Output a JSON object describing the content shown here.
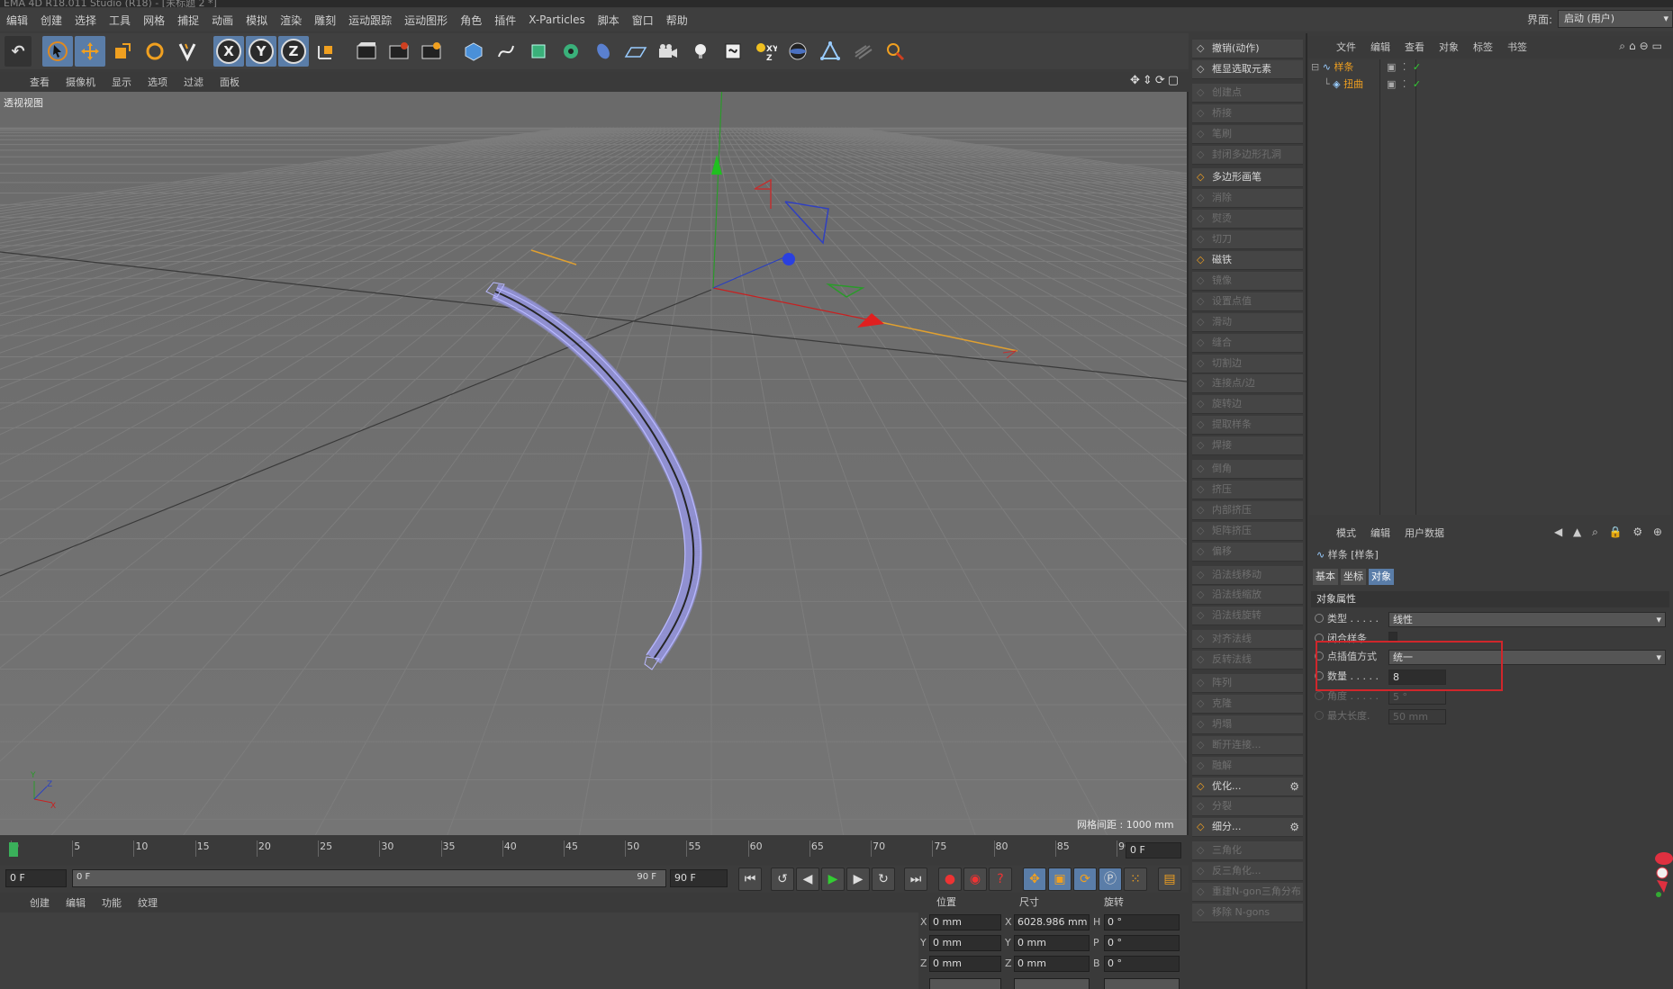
{
  "window": {
    "title": "EMA 4D R18.011 Studio (R18) - [未标题 2 *]"
  },
  "menubar": {
    "items": [
      "编辑",
      "创建",
      "选择",
      "工具",
      "网格",
      "捕捉",
      "动画",
      "模拟",
      "渲染",
      "雕刻",
      "运动跟踪",
      "运动图形",
      "角色",
      "插件",
      "X-Particles",
      "脚本",
      "窗口",
      "帮助"
    ],
    "layout_label": "界面:",
    "layout_value": "启动 (用户)"
  },
  "viewport": {
    "menu": [
      "查看",
      "摄像机",
      "显示",
      "选项",
      "过滤",
      "面板"
    ],
    "label": "透视视图",
    "grid_info": "网格间距 : 1000 mm"
  },
  "timeline": {
    "ticks": [
      "0",
      "5",
      "10",
      "15",
      "20",
      "25",
      "30",
      "35",
      "40",
      "45",
      "50",
      "55",
      "60",
      "65",
      "70",
      "75",
      "80",
      "85",
      "90"
    ],
    "current_frame": "0 F",
    "start": "0 F",
    "range_start": "0 F",
    "range_end": "90 F",
    "end": "90 F"
  },
  "material": {
    "menu": [
      "创建",
      "编辑",
      "功能",
      "纹理"
    ]
  },
  "coords": {
    "headers": [
      "位置",
      "尺寸",
      "旋转"
    ],
    "rows": [
      {
        "axis": "X",
        "pos": "0 mm",
        "size_axis": "X",
        "size": "6028.986 mm",
        "rot_axis": "H",
        "rot": "0 °"
      },
      {
        "axis": "Y",
        "pos": "0 mm",
        "size_axis": "Y",
        "size": "0 mm",
        "rot_axis": "P",
        "rot": "0 °"
      },
      {
        "axis": "Z",
        "pos": "0 mm",
        "size_axis": "Z",
        "size": "0 mm",
        "rot_axis": "B",
        "rot": "0 °"
      }
    ]
  },
  "commands": [
    {
      "label": "撤销(动作)",
      "dim": false
    },
    {
      "label": "框显选取元素",
      "dim": false
    },
    {
      "label": "创建点",
      "dim": true
    },
    {
      "label": "桥接",
      "dim": true
    },
    {
      "label": "笔刷",
      "dim": true
    },
    {
      "label": "封闭多边形孔洞",
      "dim": true
    },
    {
      "label": "多边形画笔",
      "dim": false
    },
    {
      "label": "消除",
      "dim": true
    },
    {
      "label": "熨烫",
      "dim": true
    },
    {
      "label": "切刀",
      "dim": true
    },
    {
      "label": "磁铁",
      "dim": false
    },
    {
      "label": "镜像",
      "dim": true
    },
    {
      "label": "设置点值",
      "dim": true
    },
    {
      "label": "滑动",
      "dim": true
    },
    {
      "label": "缝合",
      "dim": true
    },
    {
      "label": "切割边",
      "dim": true
    },
    {
      "label": "连接点/边",
      "dim": true
    },
    {
      "label": "旋转边",
      "dim": true
    },
    {
      "label": "提取样条",
      "dim": true
    },
    {
      "label": "焊接",
      "dim": true
    },
    {
      "label": "倒角",
      "dim": true
    },
    {
      "label": "挤压",
      "dim": true
    },
    {
      "label": "内部挤压",
      "dim": true
    },
    {
      "label": "矩阵挤压",
      "dim": true
    },
    {
      "label": "偏移",
      "dim": true
    },
    {
      "label": "沿法线移动",
      "dim": true
    },
    {
      "label": "沿法线缩放",
      "dim": true
    },
    {
      "label": "沿法线旋转",
      "dim": true
    },
    {
      "label": "对齐法线",
      "dim": true
    },
    {
      "label": "反转法线",
      "dim": true
    },
    {
      "label": "阵列",
      "dim": true
    },
    {
      "label": "克隆",
      "dim": true
    },
    {
      "label": "坍塌",
      "dim": true
    },
    {
      "label": "断开连接...",
      "dim": true
    },
    {
      "label": "融解",
      "dim": true
    },
    {
      "label": "优化...",
      "dim": false
    },
    {
      "label": "分裂",
      "dim": true
    },
    {
      "label": "细分...",
      "dim": false
    },
    {
      "label": "三角化",
      "dim": true
    },
    {
      "label": "反三角化...",
      "dim": true
    },
    {
      "label": "重建N-gon三角分布",
      "dim": true
    },
    {
      "label": "移除 N-gons",
      "dim": true
    }
  ],
  "objects": {
    "menu": [
      "文件",
      "编辑",
      "查看",
      "对象",
      "标签",
      "书签"
    ],
    "tree": [
      {
        "name": "样条"
      },
      {
        "name": "扭曲"
      }
    ]
  },
  "attributes": {
    "menu": [
      "模式",
      "编辑",
      "用户数据"
    ],
    "title": "样条 [样条]",
    "tabs": [
      "基本",
      "坐标",
      "对象"
    ],
    "section": "对象属性",
    "fields": {
      "type_label": "类型 . . . . .",
      "type_value": "线性",
      "closed_label": "闭合样条",
      "interp_label": "点插值方式",
      "interp_value": "统一",
      "count_label": "数量 . . . . .",
      "count_value": "8",
      "angle_label": "角度 . . . . .",
      "angle_value": "5 °",
      "maxlen_label": "最大长度.",
      "maxlen_value": "50 mm"
    }
  },
  "colors": {
    "accent": "#5a7da8",
    "highlight_box": "#d0262b",
    "object_orange": "#f0a020"
  }
}
